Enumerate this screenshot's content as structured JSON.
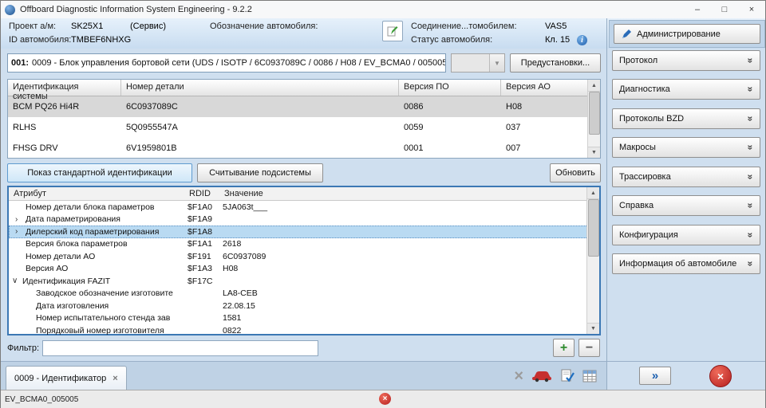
{
  "window": {
    "title": "Offboard Diagnostic Information System Engineering - 9.2.2"
  },
  "header": {
    "project_label": "Проект а/м:",
    "project_value": "SK25X1",
    "project_mode": "(Сервис)",
    "designation_label": "Обозначение автомобиля:",
    "connection_label": "Соединение...томобилем:",
    "connection_value": "VAS5",
    "vehicle_id_label": "ID автомобиля:",
    "vehicle_id_value": "TMBEF6NHXG",
    "status_label": "Статус автомобиля:",
    "status_value": "Кл. 15"
  },
  "admin": {
    "label": "Администрирование"
  },
  "sidebar": {
    "items": [
      {
        "label": "Протокол"
      },
      {
        "label": "Диагностика"
      },
      {
        "label": "Протоколы BZD"
      },
      {
        "label": "Макросы"
      },
      {
        "label": "Трассировка"
      },
      {
        "label": "Справка"
      },
      {
        "label": "Конфигурация"
      },
      {
        "label": "Информация об автомобиле"
      }
    ]
  },
  "control_unit": {
    "index": "001:",
    "title": "0009 - Блок управления бортовой сети  (UDS / ISOTP / 6C0937089C / 0086 / H08 / EV_BCMA0 / 005005",
    "presets": "Предустановки..."
  },
  "system_table": {
    "col_system": "Идентификация системы",
    "col_part": "Номер детали",
    "col_sw": "Версия ПО",
    "col_hw": "Версия АО",
    "rows": [
      {
        "system": "BCM PQ26 Hi4R",
        "part": "6C0937089C",
        "sw": "0086",
        "hw": "H08"
      },
      {
        "system": "RLHS",
        "part": "5Q0955547A",
        "sw": "0059",
        "hw": "037"
      },
      {
        "system": "FHSG DRV",
        "part": "6V1959801B",
        "sw": "0001",
        "hw": "007"
      }
    ]
  },
  "actions": {
    "show_standard": "Показ стандартной идентификации",
    "read_subsystem": "Считывание подсистемы",
    "refresh": "Обновить"
  },
  "attribute_table": {
    "col_attr": "Атрибут",
    "col_rdid": "RDID",
    "col_value": "Значение",
    "rows": [
      {
        "attr": "Номер детали блока параметров",
        "rdid": "$F1A0",
        "value": "5JA063t___"
      },
      {
        "attr": "Дата параметрирования",
        "rdid": "$F1A9",
        "value": ""
      },
      {
        "attr": "Дилерский код параметрирования",
        "rdid": "$F1A8",
        "value": ""
      },
      {
        "attr": "Версия блока параметров",
        "rdid": "$F1A1",
        "value": "2618"
      },
      {
        "attr": "Номер детали АО",
        "rdid": "$F191",
        "value": "6C0937089"
      },
      {
        "attr": "Версия АО",
        "rdid": "$F1A3",
        "value": "H08"
      },
      {
        "attr": "Идентификация FAZIT",
        "rdid": "$F17C",
        "value": ""
      },
      {
        "attr": "Заводское обозначение изготовите",
        "rdid": "",
        "value": "LA8-CEB"
      },
      {
        "attr": "Дата изготовления",
        "rdid": "",
        "value": "22.08.15"
      },
      {
        "attr": "Номер испытательного стенда зав",
        "rdid": "",
        "value": "1581"
      },
      {
        "attr": "Порядковый номер изготовителя",
        "rdid": "",
        "value": "0822"
      }
    ]
  },
  "filter": {
    "label": "Фильтр:",
    "value": ""
  },
  "tabbar": {
    "active_tab": "0009 - Идентификатор"
  },
  "statusbar": {
    "text": "EV_BCMA0_005005"
  },
  "icons": {
    "minimize": "–",
    "maximize": "□",
    "close": "×",
    "chevron_double": "»",
    "dropdown_arrow": "▼",
    "up_arrow": "▲",
    "down_arrow": "▼",
    "collapsed_arrow": "›",
    "expanded_arrow": "∨",
    "plus": "+",
    "minus": "−",
    "forward_chevrons": "»",
    "info": "i",
    "cross": "×"
  },
  "colors": {
    "accent_blue": "#3c78b4",
    "selection_blue": "#b9daf2",
    "cancel_red": "#b51f1f",
    "plus_green": "#2e8b2e"
  }
}
